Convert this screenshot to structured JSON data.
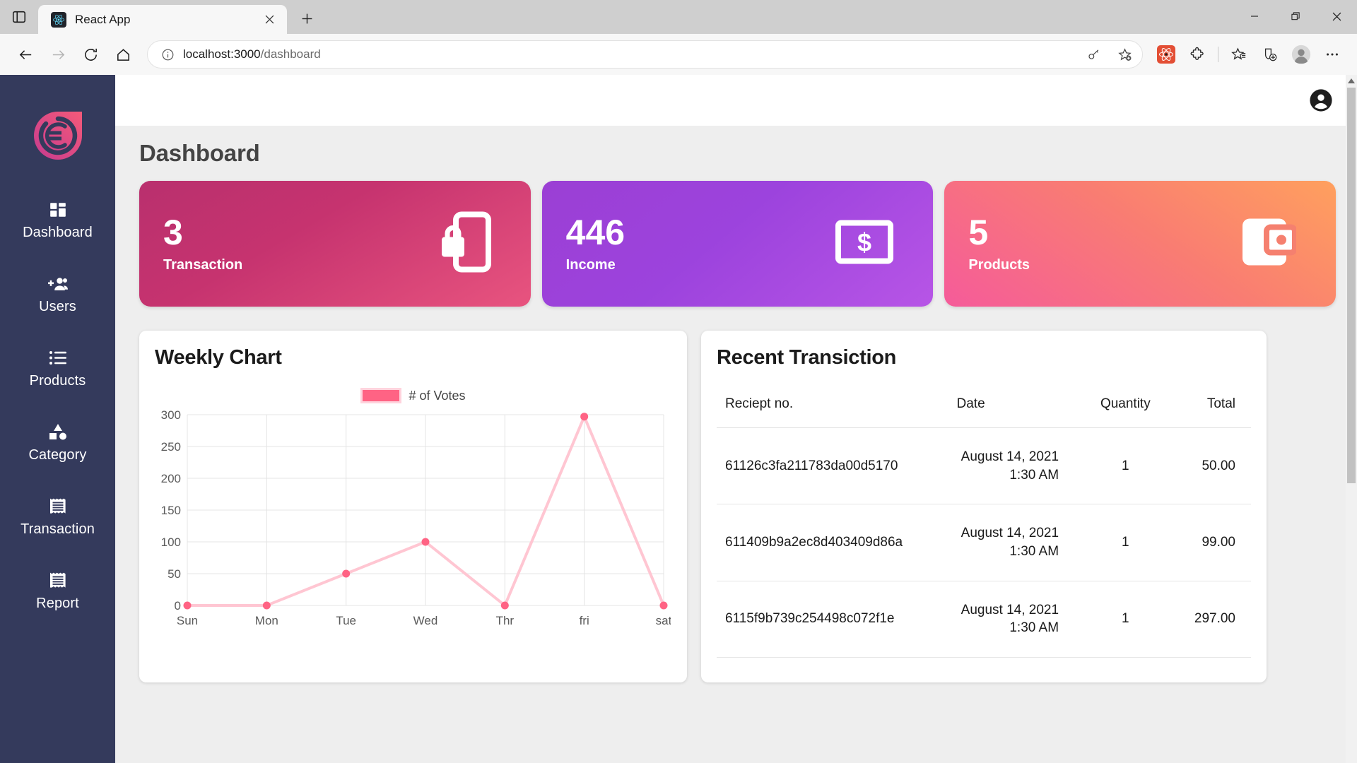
{
  "browser": {
    "tab": {
      "title": "React App",
      "favicon": "react-icon",
      "close_label": "×"
    },
    "new_tab_label": "+",
    "window_controls": {
      "minimize": "—",
      "maximize": "▢",
      "close": "✕"
    },
    "nav": {
      "back": "←",
      "forward": "→",
      "reload": "⟳",
      "home": "⌂"
    },
    "url": {
      "host": "localhost:3000",
      "path": "/dashboard",
      "full": "localhost:3000/dashboard"
    },
    "url_actions": [
      "key-icon",
      "add-favorite-icon"
    ],
    "toolbar_icons": [
      "react-devtools-extension-icon",
      "extensions-puzzle-icon",
      "favorites-star-icon",
      "collections-icon",
      "profile-avatar-icon",
      "settings-more-icon"
    ]
  },
  "sidebar": {
    "logo_alt": "euro-coin-logo",
    "items": [
      {
        "label": "Dashboard",
        "icon": "dashboard-grid-icon"
      },
      {
        "label": "Users",
        "icon": "add-users-icon"
      },
      {
        "label": "Products",
        "icon": "list-icon"
      },
      {
        "label": "Category",
        "icon": "shapes-category-icon"
      },
      {
        "label": "Transaction",
        "icon": "receipt-icon"
      },
      {
        "label": "Report",
        "icon": "receipt-icon"
      }
    ]
  },
  "appbar": {
    "account_icon": "account-circle-icon"
  },
  "page": {
    "title": "Dashboard",
    "stats": [
      {
        "value": "3",
        "label": "Transaction",
        "icon": "phone-lock-icon",
        "color": "#c6336f"
      },
      {
        "value": "446",
        "label": "Income",
        "icon": "money-bill-icon",
        "color": "#9c43dd"
      },
      {
        "value": "5",
        "label": "Products",
        "icon": "wallet-icon",
        "color": "#f97d72"
      }
    ],
    "chart_panel_title": "Weekly Chart",
    "table_panel_title": "Recent Transiction",
    "table": {
      "headers": [
        "Reciept no.",
        "Date",
        "Quantity",
        "Total"
      ],
      "rows": [
        {
          "receipt": "61126c3fa211783da00d5170",
          "date": "August 14, 2021",
          "time": "1:30 AM",
          "quantity": "1",
          "total": "50.00"
        },
        {
          "receipt": "611409b9a2ec8d403409d86a",
          "date": "August 14, 2021",
          "time": "1:30 AM",
          "quantity": "1",
          "total": "99.00"
        },
        {
          "receipt": "6115f9b739c254498c072f1e",
          "date": "August 14, 2021",
          "time": "1:30 AM",
          "quantity": "1",
          "total": "297.00"
        }
      ]
    }
  },
  "chart_data": {
    "type": "line",
    "title": "Weekly Chart",
    "categories": [
      "Sun",
      "Mon",
      "Tue",
      "Wed",
      "Thr",
      "fri",
      "sat"
    ],
    "series": [
      {
        "name": "# of Votes",
        "values": [
          0,
          0,
          50,
          100,
          0,
          297,
          0
        ],
        "color": "#ff6384",
        "line_color": "#ffc6d2"
      }
    ],
    "legend": [
      "# of Votes"
    ],
    "legend_position": "top",
    "yticks": [
      0,
      50,
      100,
      150,
      200,
      250,
      300
    ],
    "ylim": [
      0,
      300
    ],
    "xlabel": "",
    "ylabel": "",
    "grid": true
  },
  "scrollbar": {
    "up_arrow": "▲"
  }
}
